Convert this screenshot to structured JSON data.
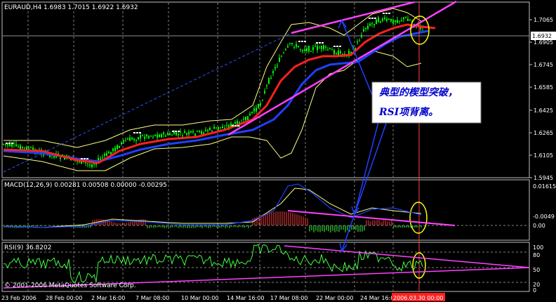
{
  "main": {
    "title": "EURAUD,H4  1.6983 1.7015 1.6922 1.6932",
    "price_ticks": [
      "1.7065",
      "1.6905",
      "1.6745",
      "1.6585",
      "1.6425",
      "1.6265",
      "1.6105",
      "1.5945"
    ],
    "current_price": "1.6932"
  },
  "macd": {
    "title": "MACD(12,26,9) 0.00281 0.00508 0.00000 -0.00295",
    "ticks": [
      "0.01615",
      "0.00",
      "-0.0049"
    ]
  },
  "rsi": {
    "title": "RSI(9) 36.8202",
    "ticks": [
      "100",
      "80",
      "50",
      "20",
      "0"
    ]
  },
  "time_axis": [
    "23 Feb 2006",
    "28 Feb 00:00",
    "2 Mar 16:00",
    "7 Mar 08:00",
    "10 Mar 00:00",
    "14 Mar 16:00",
    "17 Mar 08:00",
    "22 Mar 00:00",
    "24 Mar 16:00",
    "2006.03.30 00:00"
  ],
  "annotation": {
    "line1": "典型的楔型突破，",
    "line2": "RSI项背离。"
  },
  "copyright": "© 2001-2006 MetaQuotes Software Corp.",
  "colors": {
    "background": "#000000",
    "candle_up": "#00ff00",
    "bollinger": "#ffff80",
    "ma_red": "#ff2020",
    "ma_blue": "#2040ff",
    "trend_magenta": "#ff40ff",
    "macd_signal": "#ffff80",
    "macd_line": "#2040ff",
    "hist_up": "#ff4040",
    "hist_down": "#40ff40",
    "cursor_line": "#ff4040",
    "ellipse": "#ffff00",
    "annotation_box": "#ffffff",
    "annotation_text": "#0000cc"
  }
}
